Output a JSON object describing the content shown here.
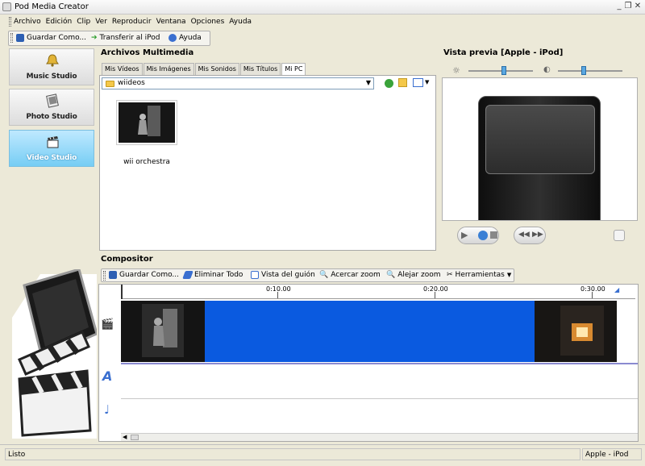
{
  "window": {
    "title": "Pod Media Creator"
  },
  "menu": [
    "Archivo",
    "Edición",
    "Clip",
    "Ver",
    "Reproducir",
    "Ventana",
    "Opciones",
    "Ayuda"
  ],
  "toolbar": {
    "save": "Guardar Como...",
    "transfer": "Transferir al iPod",
    "help": "Ayuda"
  },
  "studios": [
    {
      "label": "Music Studio",
      "icon": "bell-icon",
      "active": false
    },
    {
      "label": "Photo Studio",
      "icon": "photo-icon",
      "active": false
    },
    {
      "label": "Video Studio",
      "icon": "clapper-icon",
      "active": true
    }
  ],
  "media": {
    "header": "Archivos Multimedia",
    "tabs": [
      "Mis Vídeos",
      "Mis Imágenes",
      "Mis Sonidos",
      "Mis Títulos",
      "Mi PC"
    ],
    "selected_tab": "Mi PC",
    "path": "wiideos",
    "files": [
      {
        "name": "wii orchestra"
      }
    ]
  },
  "preview": {
    "header": "Vista previa [Apple - iPod]",
    "brightness": 0.55,
    "contrast": 0.4
  },
  "compositor": {
    "header": "Compositor",
    "toolbar": {
      "save": "Guardar Como...",
      "delete_all": "Eliminar Todo",
      "script_view": "Vista del guión",
      "zoom_in": "Acercar zoom",
      "zoom_out": "Alejar zoom",
      "tools": "Herramientas"
    },
    "ruler": [
      "0:10.00",
      "0:20.00",
      "0:30.00"
    ]
  },
  "status": {
    "left": "Listo",
    "right": "Apple - iPod"
  },
  "colors": {
    "accent": "#0a5ae0",
    "active_studio": "#76cdf4"
  }
}
